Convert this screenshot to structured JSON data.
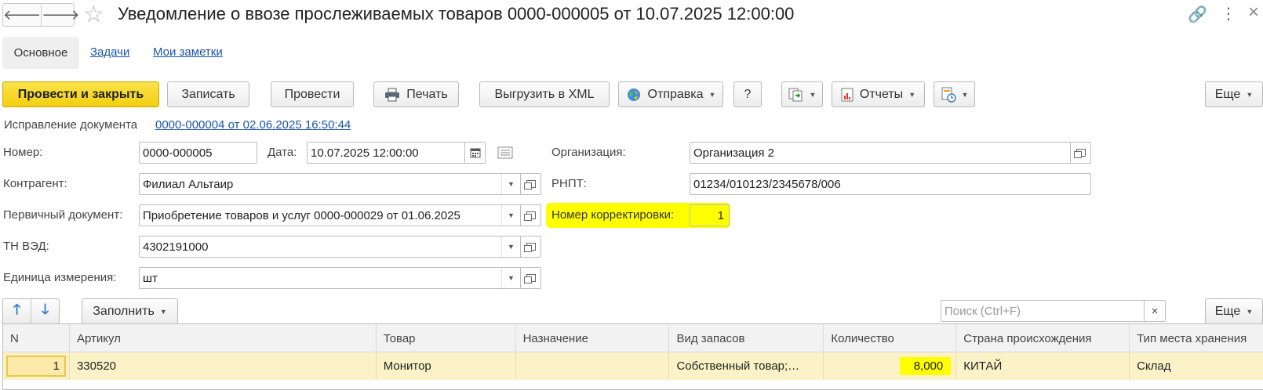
{
  "header": {
    "back_glyph": "🡐",
    "forward_glyph": "🡒",
    "star_glyph": "☆",
    "title": "Уведомление о ввозе прослеживаемых товаров 0000-000005 от 10.07.2025 12:00:00",
    "link_glyph": "🔗",
    "more_glyph": "⋮"
  },
  "tabs": {
    "main": "Основное",
    "tasks": "Задачи",
    "notes": "Мои заметки"
  },
  "toolbar": {
    "post_close": "Провести и закрыть",
    "save": "Записать",
    "post": "Провести",
    "print": "Печать",
    "export_xml": "Выгрузить в XML",
    "send": "Отправка",
    "help": "?",
    "reports": "Отчеты",
    "more": "Еще",
    "dropdown_glyph": "▼"
  },
  "correction": {
    "label": "Исправление документа",
    "link": "0000-000004 от 02.06.2025 16:50:44"
  },
  "form": {
    "number_label": "Номер:",
    "number_value": "0000-000005",
    "date_label": "Дата:",
    "date_value": "10.07.2025 12:00:00",
    "org_label": "Организация:",
    "org_value": "Организация 2",
    "counterparty_label": "Контрагент:",
    "counterparty_value": "Филиал Альтаир",
    "rnpt_label": "РНПТ:",
    "rnpt_value": "01234/010123/2345678/006",
    "primary_doc_label": "Первичный документ:",
    "primary_doc_value": "Приобретение товаров и услуг 0000-000029 от 01.06.2025",
    "correction_num_label": "Номер корректировки:",
    "correction_num_value": "1",
    "tnved_label": "ТН ВЭД:",
    "tnved_value": "4302191000",
    "unit_label": "Единица измерения:",
    "unit_value": "шт"
  },
  "table_toolbar": {
    "up_glyph": "🡑",
    "down_glyph": "🡓",
    "fill": "Заполнить",
    "search_placeholder": "Поиск (Ctrl+F)",
    "clear_glyph": "×",
    "more": "Еще"
  },
  "table": {
    "columns": [
      "N",
      "Артикул",
      "Товар",
      "Назначение",
      "Вид запасов",
      "Количество",
      "Страна происхождения",
      "Тип места хранения"
    ],
    "rows": [
      {
        "n": "1",
        "article": "330520",
        "product": "Монитор",
        "purpose": "",
        "stock_type": "Собственный товар;…",
        "quantity": "8,000",
        "country": "КИТАЙ",
        "storage": "Склад"
      }
    ]
  },
  "colors": {
    "accent_yellow": "#f7d619",
    "highlight": "#ffff00",
    "row_selected": "#fbf2c7",
    "link": "#1a55a8"
  }
}
